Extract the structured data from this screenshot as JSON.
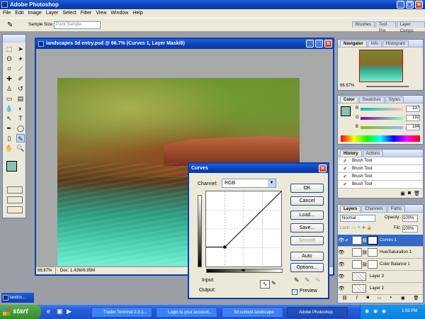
{
  "app": {
    "title": "Adobe Photoshop"
  },
  "menu": [
    "File",
    "Edit",
    "Image",
    "Layer",
    "Select",
    "Filter",
    "View",
    "Window",
    "Help"
  ],
  "options_bar": {
    "sample_size_label": "Sample Size:",
    "sample_size_value": "Point Sample"
  },
  "palette_well": [
    "Brushes",
    "Tool Pre",
    "Layer Comps"
  ],
  "document": {
    "title": "landscapes 3d entry.psd @ 66.7% (Curves 1, Layer Mask/8)",
    "zoom": "66.67%",
    "doc_size": "Doc: 1.42M/6.95M"
  },
  "navigator": {
    "tabs": [
      "Navigator",
      "Info",
      "Histogram"
    ],
    "zoom": "66.67%"
  },
  "color": {
    "tabs": [
      "Color",
      "Swatches",
      "Styles"
    ],
    "r": "137",
    "g": "192",
    "b": "184",
    "swatch": "#89c0b8"
  },
  "history": {
    "tabs": [
      "History",
      "Actions"
    ],
    "items": [
      "Brush Tool",
      "Brush Tool",
      "Brush Tool",
      "Brush Tool"
    ]
  },
  "layers": {
    "tabs": [
      "Layers",
      "Channels",
      "Paths"
    ],
    "blend": "Normal",
    "opacity_label": "Opacity:",
    "opacity": "100%",
    "lock_label": "Lock:",
    "fill_label": "Fill:",
    "fill": "100%",
    "items": [
      "Curves 1",
      "Hue/Saturation 1",
      "Color Balance 1",
      "Layer 3",
      "Layer 2"
    ]
  },
  "curves": {
    "title": "Curves",
    "channel_label": "Channel:",
    "channel": "RGB",
    "buttons": [
      "OK",
      "Cancel",
      "Load...",
      "Save...",
      "Smooth",
      "Auto",
      "Options..."
    ],
    "input_label": "Input:",
    "output_label": "Output:",
    "preview_label": "Preview",
    "preview_checked": true
  },
  "taskbar": {
    "start": "start",
    "tasks": [
      "Trader Terminal 2.0.1...",
      "Login to your account...",
      "3d contest landscape",
      "Adobe Photoshop"
    ],
    "clock": "1:55 PM"
  },
  "taskbar_tab": "landsc...",
  "colors": {
    "title_blue": "#0a3fb4",
    "canvas_bg": "#a7a9a9",
    "foreground": "#89c0b8"
  }
}
